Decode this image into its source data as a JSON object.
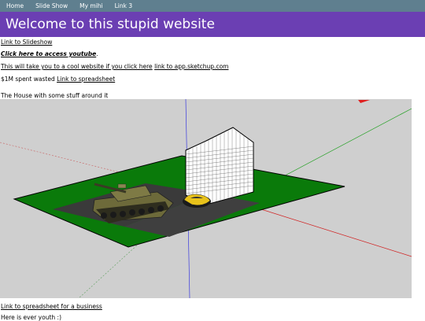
{
  "nav": {
    "items": [
      {
        "label": "Home"
      },
      {
        "label": "Slide Show"
      },
      {
        "label": "My mihi"
      },
      {
        "label": "Link 3"
      }
    ]
  },
  "header": {
    "title": "Welcome to this stupid website"
  },
  "content": {
    "slideshow_link": "Link to Slideshow",
    "youtube_link": "Click here to access youtube",
    "youtube_suffix": ".",
    "cool_text": "This will take you to a cool website if you click here",
    "sketchup_link": "link to app.sketchup.com",
    "wasted_text": "$1M spent wasted",
    "spreadsheet_link": "Link to spreadsheet",
    "house_caption": "The House with some stuff around it",
    "business_link": "Link to spreadsheet for a business",
    "bottom_text": "Here is ever youth :)"
  },
  "colors": {
    "nav_bg": "#5f7f8f",
    "banner_bg": "#6b3fb3",
    "grass": "#0a7a0a",
    "road": "#3a3a3a",
    "viewport_bg": "#cfcfcf"
  }
}
